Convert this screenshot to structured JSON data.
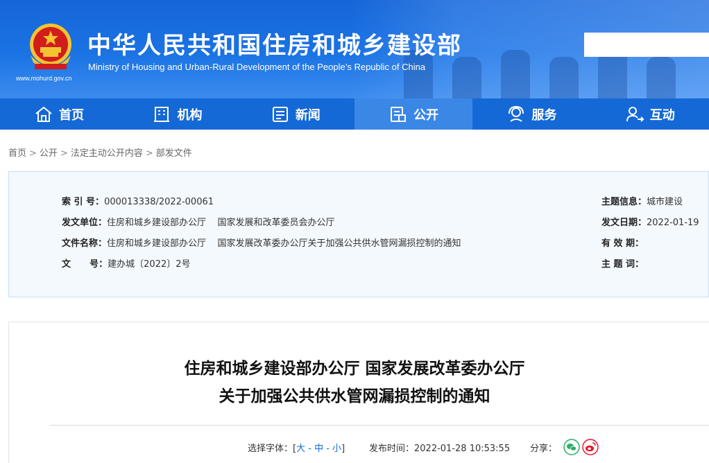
{
  "header": {
    "title_cn": "中华人民共和国住房和城乡建设部",
    "title_en": "Ministry of Housing and Urban-Rural Development of the People’s Republic of China",
    "url": "www.mohurd.gov.cn",
    "search_placeholder": ""
  },
  "nav": {
    "items": [
      {
        "label": "首页",
        "icon": "home-icon"
      },
      {
        "label": "机构",
        "icon": "building-icon"
      },
      {
        "label": "新闻",
        "icon": "newspaper-icon"
      },
      {
        "label": "公开",
        "icon": "document-icon"
      },
      {
        "label": "服务",
        "icon": "service-icon"
      },
      {
        "label": "互动",
        "icon": "interaction-icon"
      }
    ],
    "active_index": 3
  },
  "breadcrumb": {
    "items": [
      "首页",
      "公开",
      "法定主动公开内容",
      "部发文件"
    ],
    "separator": ">"
  },
  "info": {
    "index_label": "索 引 号：",
    "index_value": "000013338/2022-00061",
    "issuer_label": "发文单位：",
    "issuer_value": "住房和城乡建设部办公厅    国家发展和改革委员会办公厅",
    "docname_label": "文件名称：",
    "docname_value": "住房和城乡建设部办公厅    国家发展改革委办公厅关于加强公共供水管网漏损控制的通知",
    "docnum_label": "文      号：",
    "docnum_value": "建办城〔2022〕2号",
    "topic_label": "主题信息：",
    "topic_value": "城市建设",
    "date_label": "发文日期：",
    "date_value": "2022-01-19",
    "validity_label": "有 效 期：",
    "validity_value": "",
    "keywords_label": "主 题 词：",
    "keywords_value": ""
  },
  "article": {
    "title_line1": "住房和城乡建设部办公厅    国家发展改革委办公厅",
    "title_line2": "关于加强公共供水管网漏损控制的通知",
    "font_label": "选择字体：[",
    "font_large": "大",
    "font_dash1": " - ",
    "font_medium": "中",
    "font_dash2": " - ",
    "font_small": "小",
    "font_close": "]",
    "publish_label": "发布时间：",
    "publish_time": "2022-01-28 10:53:55",
    "share_label": "分享："
  },
  "colors": {
    "nav_bg": "#1569d6",
    "nav_active": "#3a87e6",
    "wechat": "#2aae67",
    "weibo": "#e6162d"
  }
}
